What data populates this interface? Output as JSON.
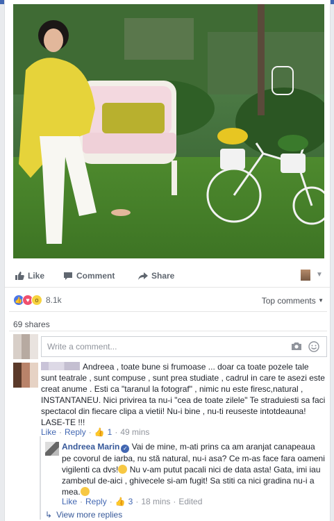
{
  "post": {
    "actions": {
      "like": "Like",
      "comment": "Comment",
      "share": "Share"
    },
    "reactions_count": "8.1k",
    "top_comments": "Top comments",
    "shares": "69 shares"
  },
  "composer": {
    "placeholder": "Write a comment..."
  },
  "comments": [
    {
      "name": "",
      "text": "Andreea , toate bune si frumoase ... doar ca toate pozele tale sunt teatrale , sunt compuse , sunt prea studiate , cadrul in care te asezi este creat anume . Esti ca \"taranul la fotograf\" , nimic nu este firesc,natural , INSTANTANEU. Nici privirea ta nu-i \"cea de toate zilele\" Te straduiesti sa faci spectacol din fiecare clipa a vietii! Nu-i bine , nu-ti reuseste intotdeauna! LASE-TE !!!",
      "meta": {
        "like": "Like",
        "reply": "Reply",
        "likes": "1",
        "time": "49 mins"
      }
    }
  ],
  "reply": {
    "name": "Andreea Marin",
    "text_part1": "Vai de mine, m-ati prins ca am aranjat canapeaua pe covorul de iarba, nu stă natural, nu-i asa? Ce m-as face fara oameni vigilenti ca dvs!",
    "text_part2": " Nu v-am putut pacali nici de data asta! Gata, imi iau zambetul de-aici , ghivecele si-am fugit! Sa stiti ca nici gradina nu-i a mea.",
    "meta": {
      "like": "Like",
      "reply": "Reply",
      "likes": "3",
      "time": "18 mins",
      "edited": "Edited"
    }
  },
  "view_more": "View more replies",
  "colors": {
    "brand": "#4267b2",
    "link": "#365899",
    "muted": "#90949c"
  }
}
